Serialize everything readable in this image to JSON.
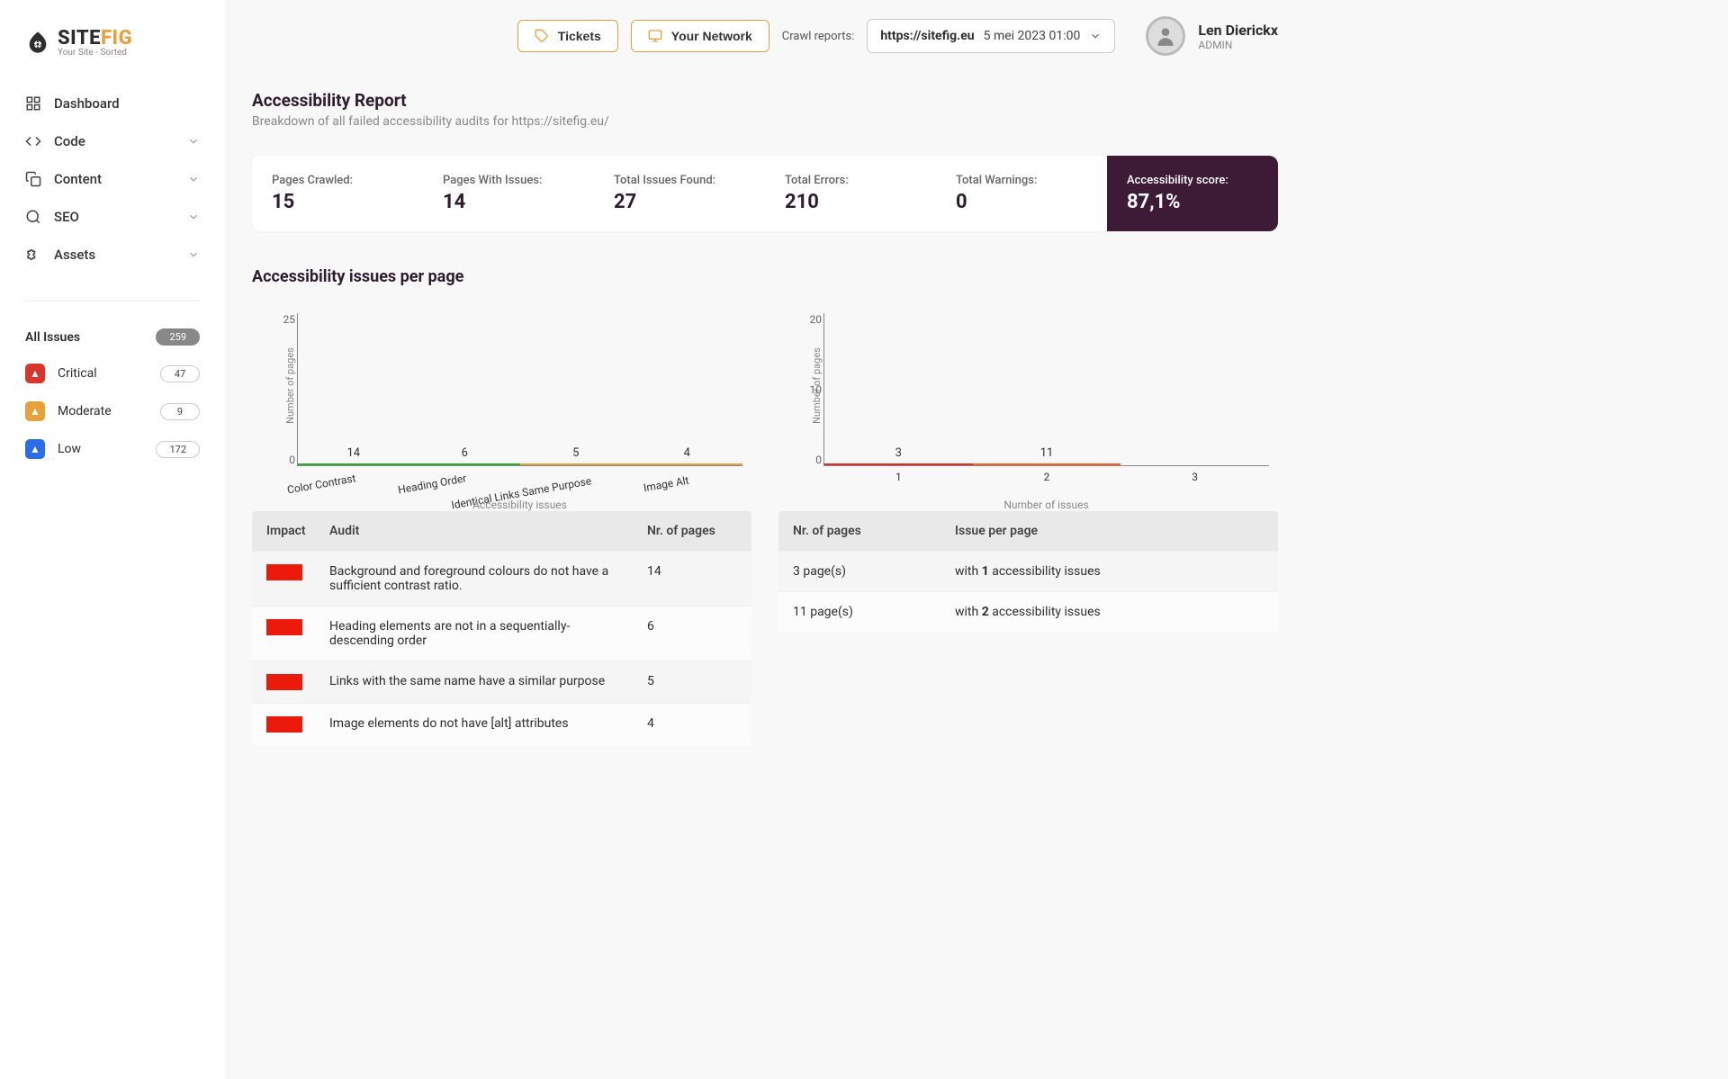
{
  "brand": {
    "site": "SITE",
    "fig": "FIG",
    "sub": "Your Site - Sorted"
  },
  "nav": {
    "dashboard": "Dashboard",
    "code": "Code",
    "content": "Content",
    "seo": "SEO",
    "assets": "Assets"
  },
  "issues": {
    "all_label": "All Issues",
    "all_count": "259",
    "critical_label": "Critical",
    "critical_count": "47",
    "moderate_label": "Moderate",
    "moderate_count": "9",
    "low_label": "Low",
    "low_count": "172"
  },
  "topbar": {
    "tickets": "Tickets",
    "network": "Your Network",
    "crawl_label": "Crawl reports:",
    "crawl_url": "https://sitefig.eu",
    "crawl_date": "5 mei 2023 01:00"
  },
  "user": {
    "name": "Len Dierickx",
    "role": "ADMIN"
  },
  "page": {
    "title": "Accessibility Report",
    "sub": "Breakdown of all failed accessibility audits for https://sitefig.eu/"
  },
  "stats": {
    "crawled_lbl": "Pages Crawled:",
    "crawled_val": "15",
    "withissues_lbl": "Pages With Issues:",
    "withissues_val": "14",
    "total_lbl": "Total Issues Found:",
    "total_val": "27",
    "errors_lbl": "Total Errors:",
    "errors_val": "210",
    "warnings_lbl": "Total Warnings:",
    "warnings_val": "0",
    "score_lbl": "Accessibility score:",
    "score_val": "87,1%"
  },
  "section_title": "Accessibility issues per page",
  "chart1": {
    "ylabel": "Number of pages",
    "xlabel": "Accessibility issues",
    "ymax_tick": "25",
    "ymin_tick": "0",
    "v0": "14",
    "v1": "6",
    "v2": "5",
    "v3": "4",
    "c0": "Color Contrast",
    "c1": "Heading Order",
    "c2": "Identical Links Same Purpose",
    "c3": "Image Alt"
  },
  "chart2": {
    "ylabel": "Number of pages",
    "xlabel": "Number of issues",
    "ymax_tick": "20",
    "ymid_tick": "10",
    "ymin_tick": "0",
    "v0": "3",
    "v1": "11",
    "v2": "",
    "c0": "1",
    "c1": "2",
    "c2": "3"
  },
  "table1": {
    "h_impact": "Impact",
    "h_audit": "Audit",
    "h_pages": "Nr. of pages",
    "r0_audit": "Background and foreground colours do not have a sufficient contrast ratio.",
    "r0_pages": "14",
    "r1_audit": "Heading elements are not in a sequentially-descending order",
    "r1_pages": "6",
    "r2_audit": "Links with the same name have a similar purpose",
    "r2_pages": "5",
    "r3_audit": "Image elements do not have [alt] attributes",
    "r3_pages": "4"
  },
  "table2": {
    "h_a": "Nr. of pages",
    "h_b": "Issue per page",
    "r0_a": "3 page(s)",
    "r0_b_pre": "with ",
    "r0_b_n": "1",
    "r0_b_post": " accessibility issues",
    "r1_a": "11 page(s)",
    "r1_b_pre": "with ",
    "r1_b_n": "2",
    "r1_b_post": " accessibility issues"
  },
  "chart_data": [
    {
      "type": "bar",
      "categories": [
        "Color Contrast",
        "Heading Order",
        "Identical Links Same Purpose",
        "Image Alt"
      ],
      "values": [
        14,
        6,
        5,
        4
      ],
      "colors": [
        "#2eaa2e",
        "#2eaa2e",
        "#e8a03c",
        "#e8a03c"
      ],
      "xlabel": "Accessibility issues",
      "ylabel": "Number of pages",
      "ylim": [
        0,
        25
      ]
    },
    {
      "type": "bar",
      "categories": [
        "1",
        "2",
        "3"
      ],
      "values": [
        3,
        11,
        0
      ],
      "colors": [
        "#e52b20",
        "#ff5a1f",
        null
      ],
      "xlabel": "Number of issues",
      "ylabel": "Number of pages",
      "ylim": [
        0,
        20
      ]
    }
  ]
}
